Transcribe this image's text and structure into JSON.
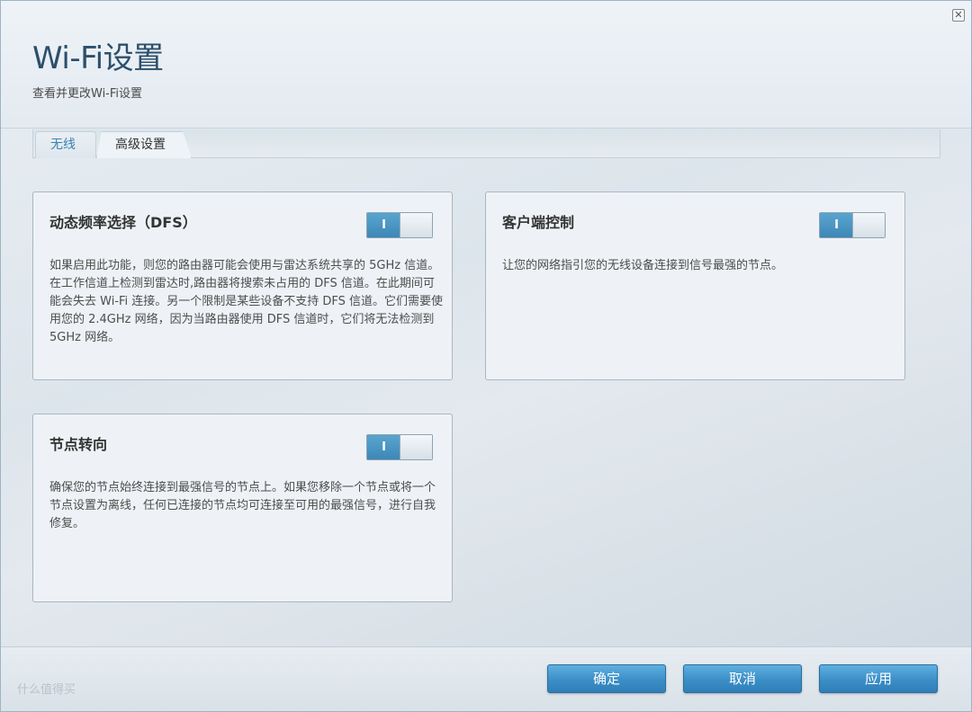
{
  "header": {
    "title": "Wi-Fi设置",
    "subtitle": "查看并更改Wi-Fi设置",
    "close_glyph": "✕"
  },
  "tabs": [
    {
      "label": "无线",
      "active": false
    },
    {
      "label": "高级设置",
      "active": true
    }
  ],
  "cards": {
    "dfs": {
      "title": "动态频率选择（DFS）",
      "toggle_label": "I",
      "enabled": true,
      "description": "如果启用此功能，则您的路由器可能会使用与雷达系统共享的 5GHz 信道。在工作信道上检测到雷达时,路由器将搜索未占用的 DFS 信道。在此期间可能会失去 Wi-Fi 连接。另一个限制是某些设备不支持 DFS 信道。它们需要使用您的 2.4GHz 网络，因为当路由器使用 DFS 信道时，它们将无法检测到 5GHz 网络。"
    },
    "client_steering": {
      "title": "客户端控制",
      "toggle_label": "I",
      "enabled": true,
      "description": "让您的网络指引您的无线设备连接到信号最强的节点。"
    },
    "node_steering": {
      "title": "节点转向",
      "toggle_label": "I",
      "enabled": true,
      "description": "确保您的节点始终连接到最强信号的节点上。如果您移除一个节点或将一个节点设置为离线，任何已连接的节点均可连接至可用的最强信号，进行自我修复。"
    }
  },
  "footer": {
    "ok_label": "确定",
    "cancel_label": "取消",
    "apply_label": "应用",
    "watermark": "什么值得买"
  },
  "colors": {
    "accent": "#3b8ec7",
    "title": "#2c4f6b",
    "tab_link": "#3b82b0"
  }
}
